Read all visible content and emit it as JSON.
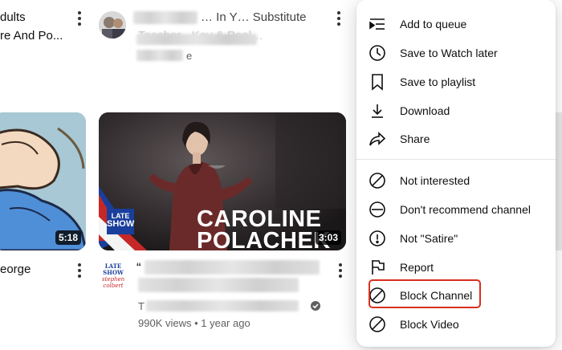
{
  "video_left_top": {
    "title_line1": "dults",
    "title_line2": "re And Po..."
  },
  "video_main_top": {
    "title_line1": "… In Y… Substitute",
    "title_line2": "Teacher - Key & Peel…",
    "meta_text": "e"
  },
  "video_left_bottom": {
    "duration": "5:18",
    "title_text": "eorge"
  },
  "video_main_bottom": {
    "duration": "3:03",
    "thumb_text_line1": "CAROLINE",
    "thumb_text_line2": "POLACHEK",
    "badge_line1": "LATE",
    "badge_line2": "SHOW",
    "channel_logo_line1": "LATE SHOW",
    "channel_logo_line2": "stephen",
    "channel_logo_line3": "colbert",
    "title_quote": "“",
    "channel_initial": "T",
    "views_age": "990K views • 1 year ago"
  },
  "menu": {
    "items": [
      {
        "label": "Add to queue",
        "icon": "queue-icon"
      },
      {
        "label": "Save to Watch later",
        "icon": "clock-icon"
      },
      {
        "label": "Save to playlist",
        "icon": "bookmark-icon"
      },
      {
        "label": "Download",
        "icon": "download-icon"
      },
      {
        "label": "Share",
        "icon": "share-icon"
      },
      {
        "label": "Not interested",
        "icon": "ban-icon"
      },
      {
        "label": "Don't recommend channel",
        "icon": "minus-circle-icon"
      },
      {
        "label": "Not \"Satire\"",
        "icon": "exclamation-circle-icon"
      },
      {
        "label": "Report",
        "icon": "flag-icon"
      },
      {
        "label": "Block Channel",
        "icon": "ban-icon"
      },
      {
        "label": "Block Video",
        "icon": "ban-icon"
      }
    ]
  },
  "colors": {
    "highlight": "#d9301f",
    "badge_blue": "#1a3e9c",
    "badge_red": "#c62828"
  }
}
